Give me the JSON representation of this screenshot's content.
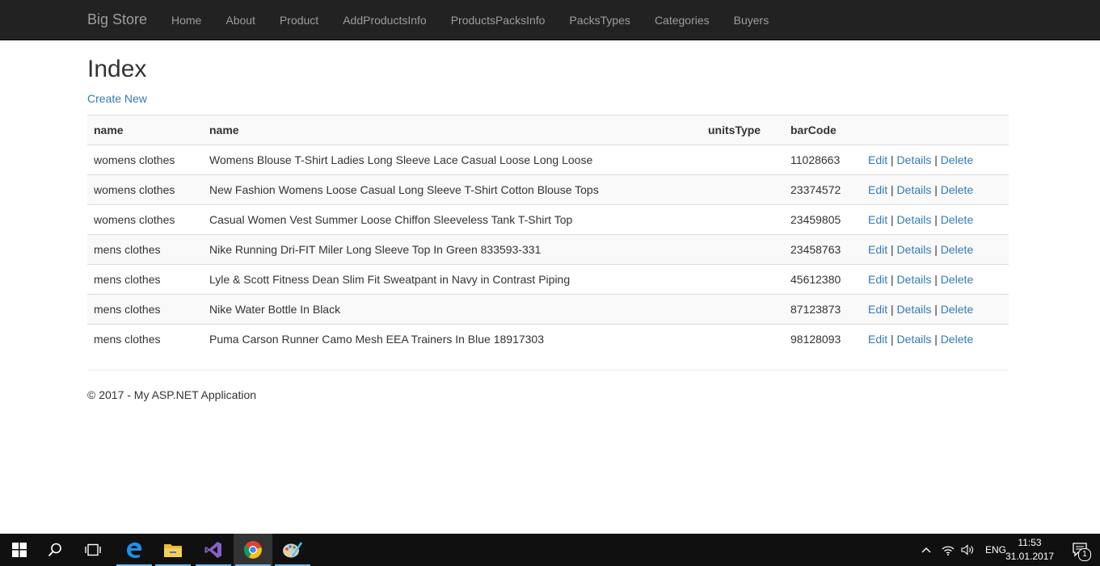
{
  "navbar": {
    "brand": "Big Store",
    "links": [
      "Home",
      "About",
      "Product",
      "AddProductsInfo",
      "ProductsPacksInfo",
      "PacksTypes",
      "Categories",
      "Buyers"
    ]
  },
  "page": {
    "title": "Index",
    "create_link": "Create New"
  },
  "table": {
    "headers": [
      "name",
      "name",
      "unitsType",
      "barCode",
      ""
    ],
    "rows": [
      {
        "category": "womens clothes",
        "name": "Womens Blouse T-Shirt Ladies Long Sleeve Lace Casual Loose Long Loose",
        "unitsType": "",
        "barCode": "11028663"
      },
      {
        "category": "womens clothes",
        "name": "New Fashion Womens Loose Casual Long Sleeve T-Shirt Cotton Blouse Tops",
        "unitsType": "",
        "barCode": "23374572"
      },
      {
        "category": "womens clothes",
        "name": "Casual Women Vest Summer Loose Chiffon Sleeveless Tank T-Shirt Top",
        "unitsType": "",
        "barCode": "23459805"
      },
      {
        "category": "mens clothes",
        "name": "Nike Running Dri-FIT Miler Long Sleeve Top In Green 833593-331",
        "unitsType": "",
        "barCode": "23458763"
      },
      {
        "category": "mens clothes",
        "name": "Lyle & Scott Fitness Dean Slim Fit Sweatpant in Navy in Contrast Piping",
        "unitsType": "",
        "barCode": "45612380"
      },
      {
        "category": "mens clothes",
        "name": "Nike Water Bottle In Black",
        "unitsType": "",
        "barCode": "87123873"
      },
      {
        "category": "mens clothes",
        "name": "Puma Carson Runner Camo Mesh EEA Trainers In Blue 18917303",
        "unitsType": "",
        "barCode": "98128093"
      }
    ],
    "actions": {
      "edit": "Edit",
      "details": "Details",
      "delete": "Delete",
      "separator": "|"
    }
  },
  "footer": {
    "text": "© 2017 - My ASP.NET Application"
  },
  "taskbar": {
    "apps": [
      "windows-start-icon",
      "search-icon",
      "task-view-icon",
      "edge-icon",
      "file-explorer-icon",
      "visual-studio-icon",
      "chrome-icon",
      "paint-icon"
    ],
    "language": "ENG",
    "time": "11:53",
    "date": "31.01.2017",
    "notification_count": "1"
  },
  "colors": {
    "navbar_bg": "#222222",
    "link": "#337ab7",
    "taskbar_bg": "#101010",
    "taskbar_accent": "#76b9ed"
  }
}
